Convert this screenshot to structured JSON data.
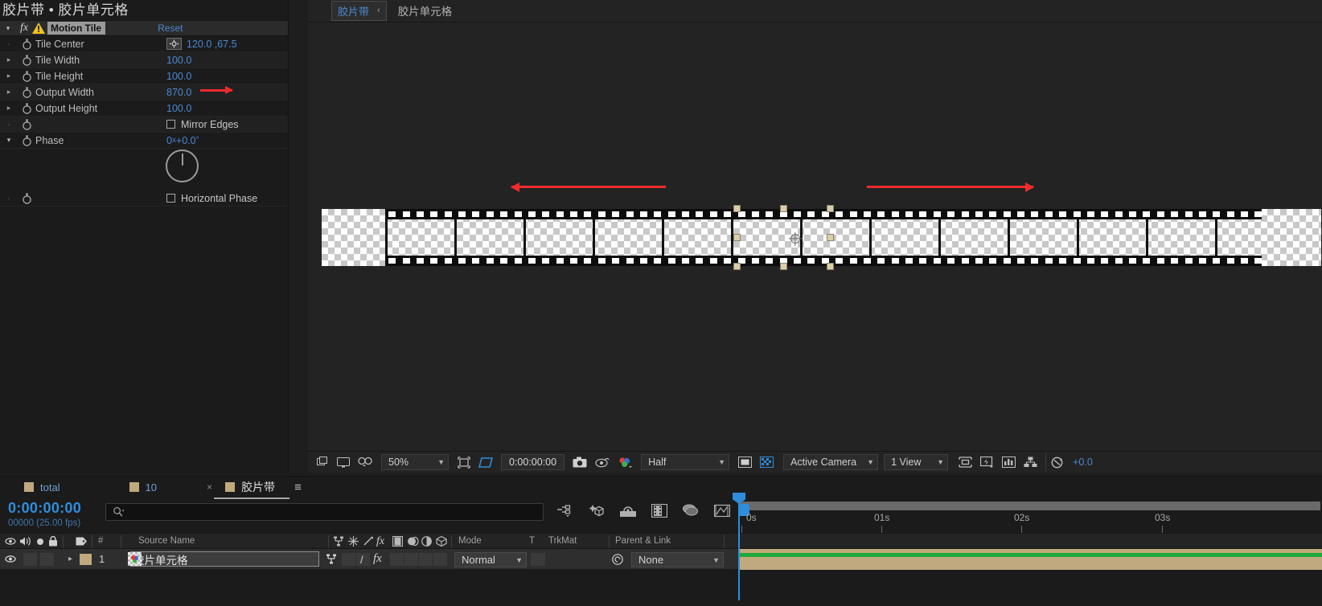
{
  "effect_controls": {
    "panel_title": "胶片带 • 胶片单元格",
    "effect_name": "Motion Tile",
    "reset_label": "Reset",
    "properties": [
      {
        "label": "Tile Center",
        "value": "120.0",
        "value2": "67.5",
        "type": "point"
      },
      {
        "label": "Tile Width",
        "value": "100.0",
        "type": "number"
      },
      {
        "label": "Tile Height",
        "value": "100.0",
        "type": "number"
      },
      {
        "label": "Output Width",
        "value": "870.0",
        "type": "number",
        "highlight": true
      },
      {
        "label": "Output Height",
        "value": "100.0",
        "type": "number"
      },
      {
        "label": "",
        "value": "Mirror Edges",
        "type": "checkbox"
      },
      {
        "label": "Phase",
        "value": "0",
        "unit_x": "x",
        "value2": "+0.0",
        "unit_deg": "°",
        "type": "angle"
      },
      {
        "label": "",
        "value": "Horizontal Phase",
        "type": "checkbox"
      }
    ]
  },
  "composition": {
    "tab_active": "胶片带",
    "tab_chevron": "‹",
    "tab_secondary": "胶片单元格"
  },
  "viewer_toolbar": {
    "zoom": "50%",
    "time": "0:00:00:00",
    "resolution": "Half",
    "camera": "Active Camera",
    "views": "1 View",
    "exposure": "+0.0",
    "icons": [
      "always-preview-this-view-icon",
      "main-viewer-icon",
      "3d-glasses-icon",
      "region-of-interest-icon",
      "transparency-grid-icon",
      "snapshot-icon",
      "show-snapshot-icon",
      "channel-icon",
      "mask-visibility-icon",
      "toggle-transparency-grid-icon",
      "guides-icon",
      "fast-previews-icon",
      "timeline-icon",
      "comp-flowchart-icon",
      "reset-exposure-icon"
    ]
  },
  "timeline": {
    "tabs": [
      {
        "label": "total",
        "active": false
      },
      {
        "label": "10",
        "active": false
      },
      {
        "label": "胶片带",
        "active": true
      }
    ],
    "close_glyph": "×",
    "menu_glyph": "≡",
    "current_time": "0:00:00:00",
    "frames_info": "00000 (25.00 fps)",
    "search_placeholder": "",
    "columns": {
      "number": "#",
      "source_name": "Source Name",
      "mode": "Mode",
      "t": "T",
      "trkmat": "TrkMat",
      "parent_link": "Parent & Link"
    },
    "ruler_labels": [
      "0s",
      "01s",
      "02s",
      "03s"
    ],
    "layers": [
      {
        "index": "1",
        "source_name": "胶片单元格",
        "mode": "Normal",
        "trkmat": "",
        "parent": "None"
      }
    ]
  },
  "colors": {
    "accent_blue": "#2f8ddc",
    "link_blue": "#4b88d0",
    "annotation_red": "#ef2b2b",
    "layer_tan": "#c0a97e",
    "green_bar": "#1fa839"
  }
}
